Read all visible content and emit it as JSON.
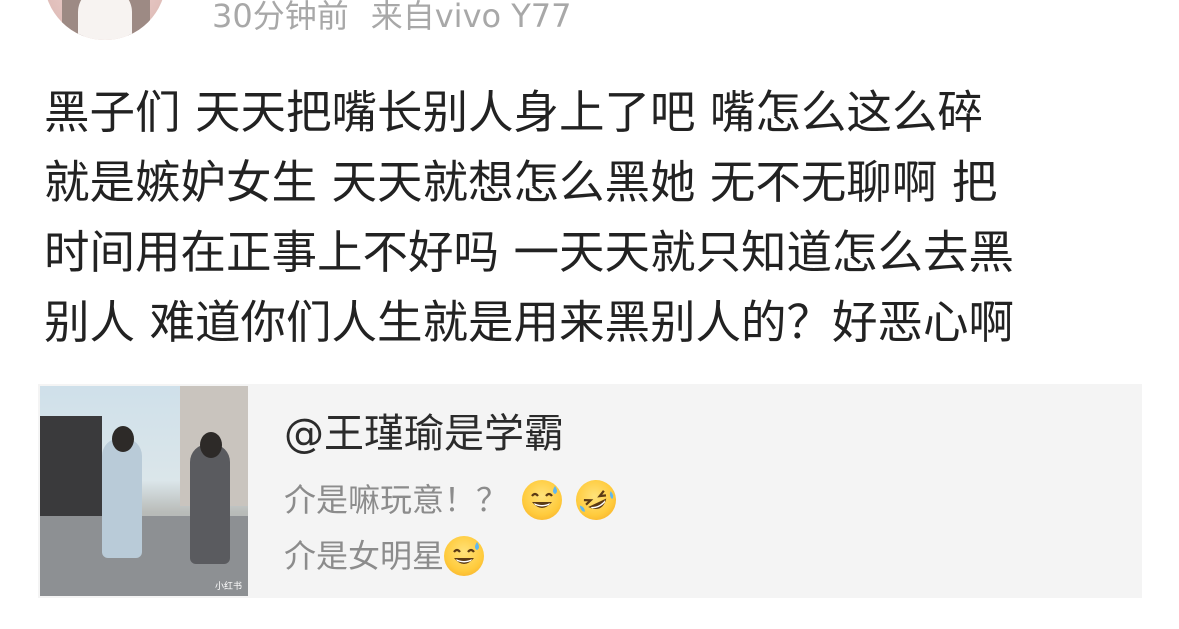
{
  "post": {
    "meta_time": "30分钟前",
    "meta_source": "来自vivo Y77",
    "text_lines": [
      "黑子们  天天把嘴长别人身上了吧  嘴怎么这么碎",
      "就是嫉妒女生  天天就想怎么黑她  无不无聊啊  把",
      "时间用在正事上不好吗  一天天就只知道怎么去黑",
      "别人  难道你们人生就是用来黑别人的？好恶心啊"
    ]
  },
  "quote": {
    "author": "@王瑾瑜是学霸",
    "line1": "介是嘛玩意！？",
    "line2": "介是女明星",
    "thumbnail_watermark": "小红书",
    "icons": [
      "grinning-sweat-emoji",
      "rolling-laughing-emoji",
      "grinning-sweat-emoji"
    ]
  }
}
